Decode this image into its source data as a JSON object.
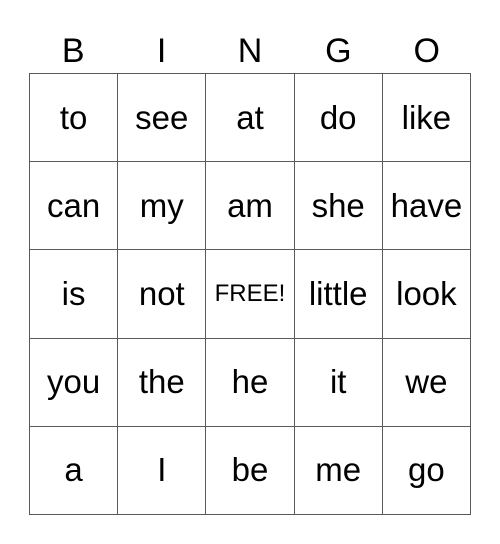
{
  "header": [
    "B",
    "I",
    "N",
    "G",
    "O"
  ],
  "cells": [
    [
      "to",
      "see",
      "at",
      "do",
      "like"
    ],
    [
      "can",
      "my",
      "am",
      "she",
      "have"
    ],
    [
      "is",
      "not",
      "FREE!",
      "little",
      "look"
    ],
    [
      "you",
      "the",
      "he",
      "it",
      "we"
    ],
    [
      "a",
      "I",
      "be",
      "me",
      "go"
    ]
  ],
  "free_space_label": "FREE!"
}
